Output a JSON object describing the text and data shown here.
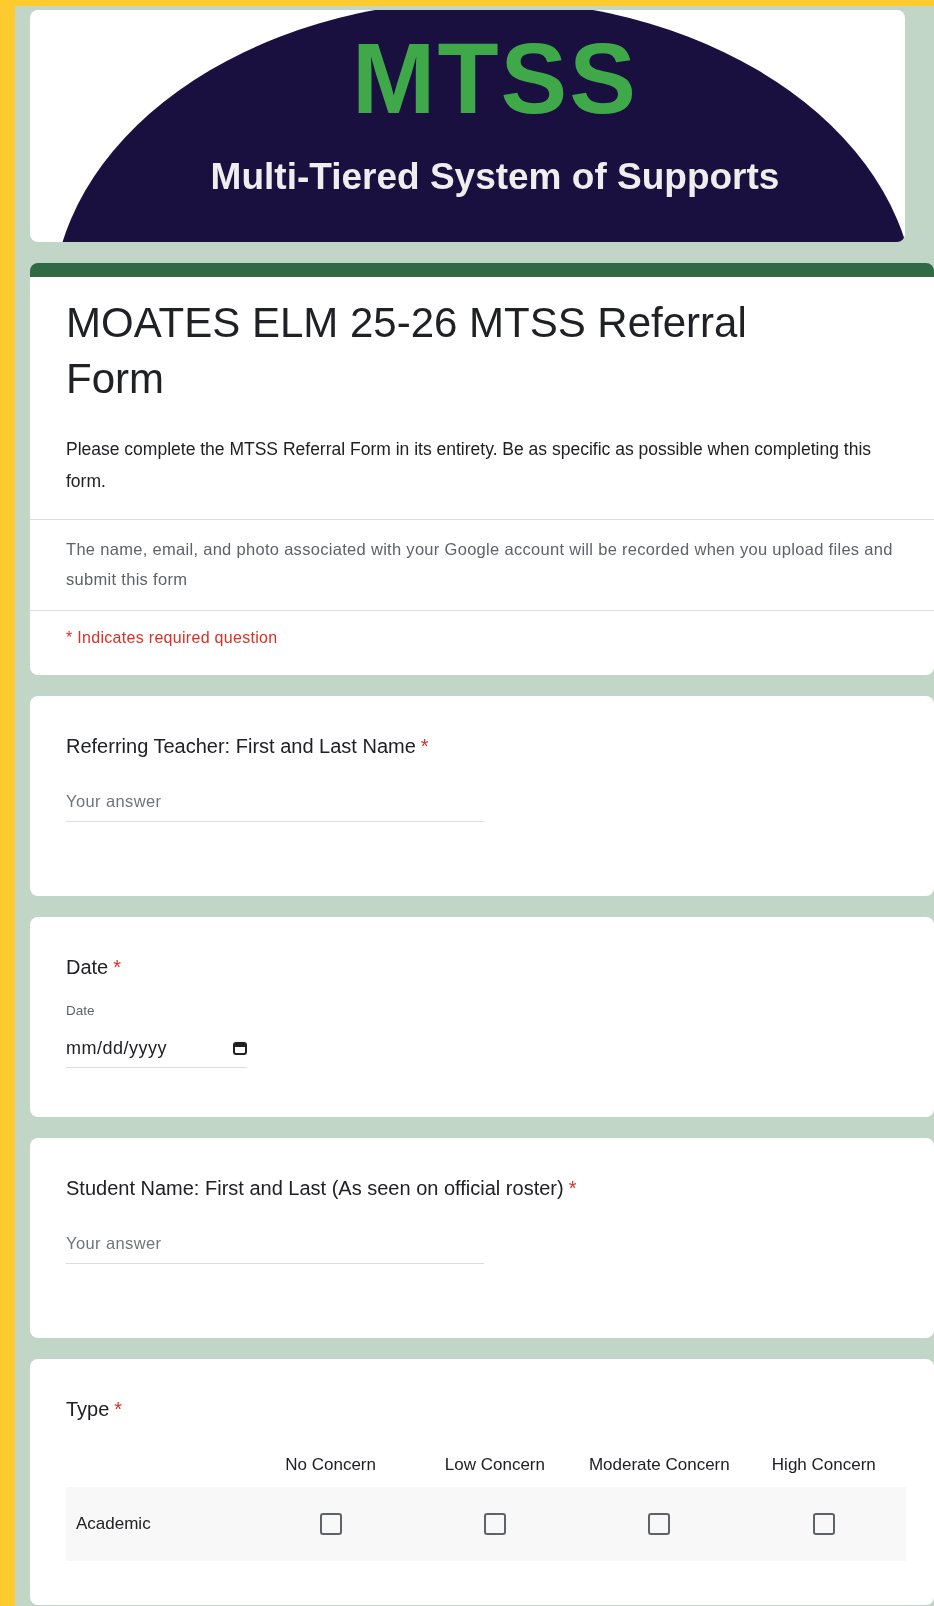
{
  "banner": {
    "logo_title": "MTSS",
    "logo_subtitle": "Multi-Tiered System of Supports"
  },
  "form": {
    "title": "MOATES ELM 25-26 MTSS Referral Form",
    "description": "Please complete the MTSS Referral Form in its entirety. Be as specific as possible when completing this form.",
    "account_notice": "The name, email, and photo associated with your Google account will be recorded when you upload files and submit this form",
    "required_note": "* Indicates required question"
  },
  "required_mark": "*",
  "questions": [
    {
      "kind": "text",
      "label": "Referring Teacher: First and Last Name",
      "required": true,
      "placeholder": "Your answer"
    },
    {
      "kind": "date",
      "label": "Date",
      "required": true,
      "sublabel": "Date",
      "placeholder": "mm/dd/yyyy"
    },
    {
      "kind": "text",
      "label": "Student Name: First and Last (As seen on official roster)",
      "required": true,
      "placeholder": "Your answer"
    },
    {
      "kind": "grid",
      "label": "Type",
      "required": true,
      "columns": [
        "No Concern",
        "Low Concern",
        "Moderate Concern",
        "High Concern"
      ],
      "rows": [
        {
          "label": "Academic",
          "cells": [
            {
              "checked": false
            },
            {
              "checked": false
            },
            {
              "checked": false
            },
            {
              "checked": false
            }
          ]
        }
      ]
    }
  ]
}
